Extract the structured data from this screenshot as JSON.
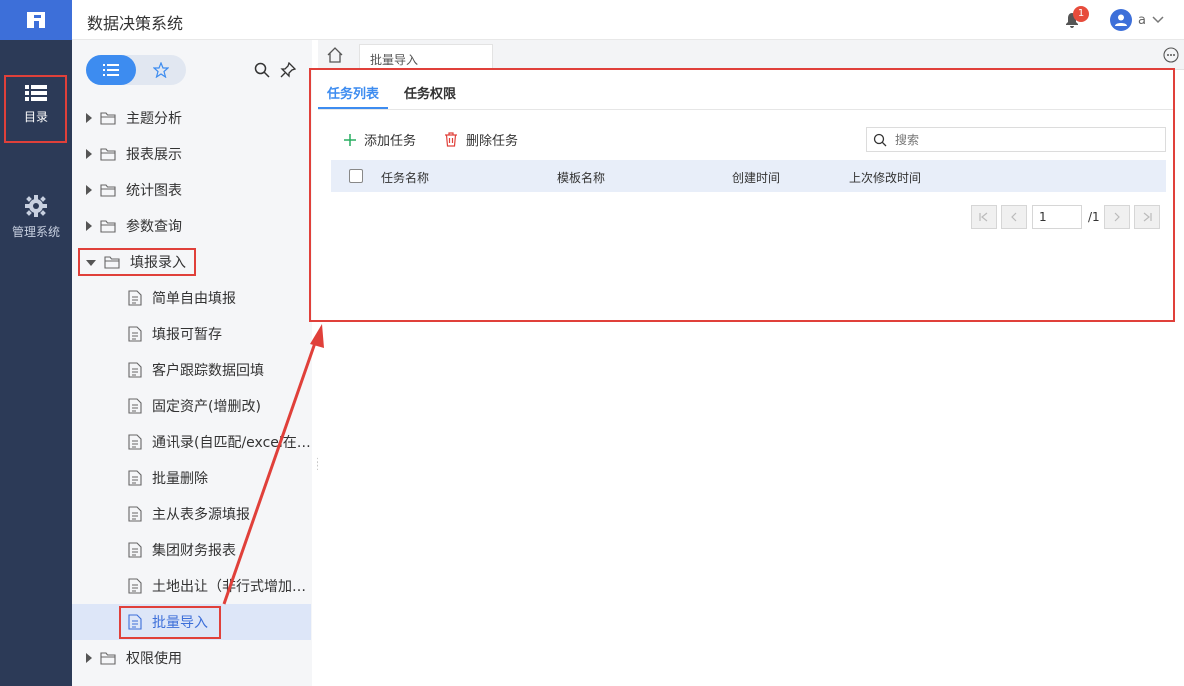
{
  "header": {
    "title": "数据决策系统",
    "notification_count": "1",
    "username": "a"
  },
  "rail": {
    "items": [
      {
        "label": "目录",
        "icon": "list-icon"
      },
      {
        "label": "管理系统",
        "icon": "gear-icon"
      }
    ]
  },
  "catalog": {
    "tree": [
      {
        "label": "主题分析",
        "expanded": false
      },
      {
        "label": "报表展示",
        "expanded": false
      },
      {
        "label": "统计图表",
        "expanded": false
      },
      {
        "label": "参数查询",
        "expanded": false
      },
      {
        "label": "填报录入",
        "expanded": true
      },
      {
        "label": "简单自由填报"
      },
      {
        "label": "填报可暂存"
      },
      {
        "label": "客户跟踪数据回填"
      },
      {
        "label": "固定资产(增删改)"
      },
      {
        "label": "通讯录(自匹配/excel在…"
      },
      {
        "label": "批量删除"
      },
      {
        "label": "主从表多源填报"
      },
      {
        "label": "集团财务报表"
      },
      {
        "label": "土地出让（非行式增加…"
      },
      {
        "label": "批量导入",
        "selected": true
      },
      {
        "label": "权限使用",
        "expanded": false
      }
    ]
  },
  "main": {
    "open_tab": "批量导入",
    "sub_tabs": [
      "任务列表",
      "任务权限"
    ],
    "toolbar": {
      "add_label": "添加任务",
      "delete_label": "删除任务",
      "search_placeholder": "搜索"
    },
    "table": {
      "columns": [
        "任务名称",
        "模板名称",
        "创建时间",
        "上次修改时间"
      ],
      "rows": []
    },
    "pager": {
      "current": "1",
      "total": "/1"
    }
  },
  "colors": {
    "accent": "#3d8cf0",
    "rail_bg": "#2c3a57",
    "annotation": "#e0403a",
    "delete": "#e0403a",
    "add": "#27ae60"
  }
}
